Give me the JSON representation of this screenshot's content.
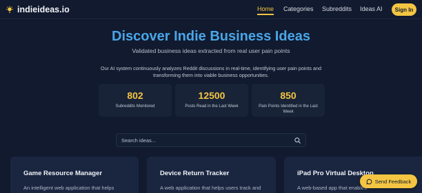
{
  "brand": {
    "name": "indieideas.io",
    "icon": "lightbulb-icon"
  },
  "nav": {
    "links": [
      {
        "label": "Home",
        "active": true
      },
      {
        "label": "Categories",
        "active": false
      },
      {
        "label": "Subreddits",
        "active": false
      },
      {
        "label": "Ideas AI",
        "active": false
      }
    ],
    "signin_label": "Sign In"
  },
  "hero": {
    "title": "Discover Indie Business Ideas",
    "subtitle": "Validated business ideas extracted from real user pain points",
    "description": "Our AI system continuously analyzes Reddit discussions in real-time, identifying user pain points and transforming them into viable business opportunities."
  },
  "stats": [
    {
      "value": "802",
      "label": "Subreddits Monitored"
    },
    {
      "value": "12500",
      "label": "Posts Read in the Last Week"
    },
    {
      "value": "850",
      "label": "Pain Points Identified in the Last Week"
    }
  ],
  "search": {
    "placeholder": "Search ideas...",
    "icon": "search-icon"
  },
  "cards": [
    {
      "title": "Game Resource Manager",
      "description": "An intelligent web application that helps"
    },
    {
      "title": "Device Return Tracker",
      "description": "A web application that helps users track and"
    },
    {
      "title": "iPad Pro Virtual Desktop",
      "description": "A web-based app that enables"
    }
  ],
  "feedback": {
    "label": "Send Feedback",
    "icon": "chat-bubble-icon"
  },
  "colors": {
    "accent": "#f4c542",
    "title": "#4aa6e8",
    "background": "#111a2e",
    "card": "#1a2640"
  }
}
